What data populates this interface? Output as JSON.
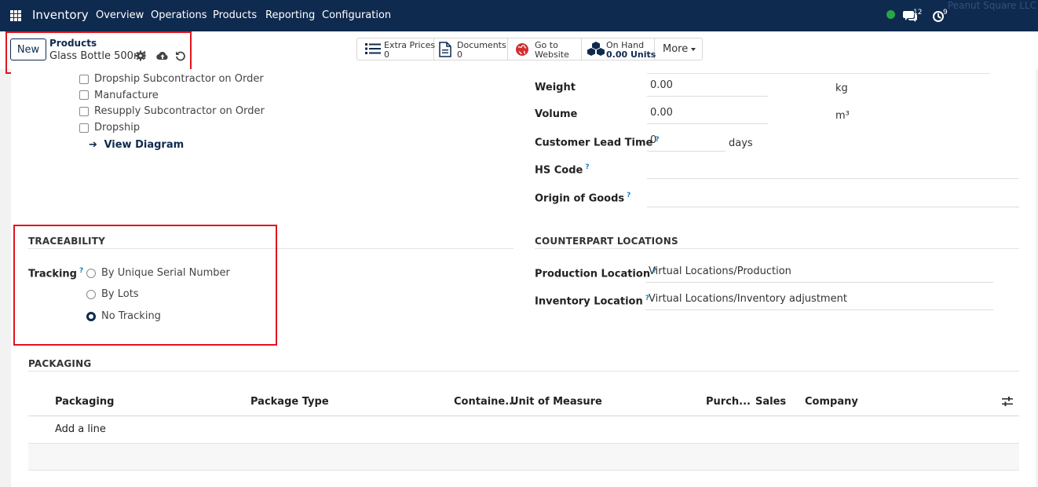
{
  "navbar": {
    "brand": "Inventory",
    "menu": [
      "Overview",
      "Operations",
      "Products",
      "Reporting",
      "Configuration"
    ],
    "chat_count": "12",
    "activity_count": "9",
    "company": "Peanut Square LLC"
  },
  "control_panel": {
    "new_label": "New",
    "breadcrumb_parent": "Products",
    "breadcrumb_current": "Glass Bottle 500ml",
    "stats": [
      {
        "label": "Extra Prices",
        "value": "0"
      },
      {
        "label": "Documents",
        "value": "0"
      },
      {
        "label": "Go to",
        "value": "Website"
      },
      {
        "label": "On Hand",
        "value": "0.00 Units"
      }
    ],
    "more_label": "More"
  },
  "routes": {
    "items": [
      "Dropship Subcontractor on Order",
      "Manufacture",
      "Resupply Subcontractor on Order",
      "Dropship"
    ],
    "view_diagram": "View Diagram"
  },
  "logistics": {
    "weight_label": "Weight",
    "weight_value": "0.00",
    "weight_unit": "kg",
    "volume_label": "Volume",
    "volume_value": "0.00",
    "volume_unit": "m³",
    "lead_time_label": "Customer Lead Time",
    "lead_time_value": "0",
    "lead_time_unit": "days",
    "hs_code_label": "HS Code",
    "hs_code_value": "",
    "origin_label": "Origin of Goods",
    "origin_value": ""
  },
  "traceability": {
    "title": "TRACEABILITY",
    "tracking_label": "Tracking",
    "options": [
      "By Unique Serial Number",
      "By Lots",
      "No Tracking"
    ],
    "selected": "No Tracking"
  },
  "counterpart": {
    "title": "COUNTERPART LOCATIONS",
    "production_label": "Production Location",
    "production_value": "Virtual Locations/Production",
    "inventory_label": "Inventory Location",
    "inventory_value": "Virtual Locations/Inventory adjustment"
  },
  "packaging": {
    "title": "PACKAGING",
    "columns": [
      "Packaging",
      "Package Type",
      "Containe...",
      "Unit of Measure",
      "Purch...",
      "Sales",
      "Company"
    ],
    "add_line": "Add a line"
  },
  "help_mark": "?",
  "colors": {
    "navbar": "#0f2a4f",
    "highlight": "#e0141e",
    "status_online": "#28a745",
    "help": "#1a7fb2"
  }
}
